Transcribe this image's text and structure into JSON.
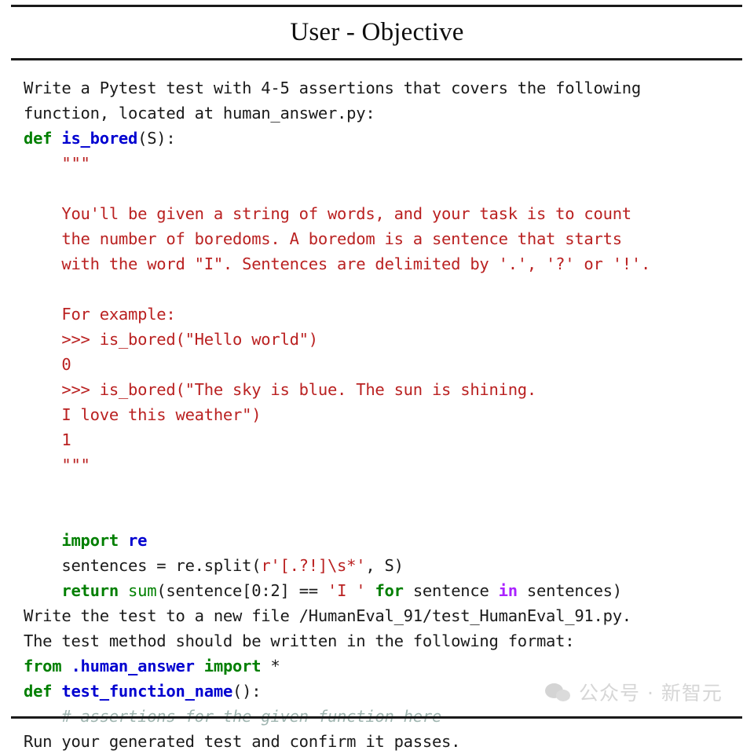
{
  "header": {
    "title": "User - Objective"
  },
  "watermark": {
    "text": "公众号 · 新智元",
    "logo_icon": "wechat-logo-icon",
    "color": "#d4d4d4"
  },
  "colors": {
    "keyword": "#007f00",
    "builtin_keyword": "#aa22ff",
    "function_name": "#0000d0",
    "builtin_function": "#008000",
    "string": "#ba2121",
    "comment": "#9fb5b0",
    "text": "#1a1a1a",
    "rule": "#1a1a1a",
    "background": "#ffffff"
  },
  "content": {
    "lines": [
      {
        "id": "intro-1",
        "segments": [
          {
            "cls": "plain",
            "t": "Write a Pytest test with 4-5 assertions that covers the following"
          }
        ]
      },
      {
        "id": "intro-2",
        "segments": [
          {
            "cls": "plain",
            "t": "function, located at human_answer.py:"
          }
        ]
      },
      {
        "id": "def-is-bored",
        "segments": [
          {
            "cls": "kw",
            "t": "def"
          },
          {
            "cls": "plain",
            "t": " "
          },
          {
            "cls": "fn",
            "t": "is_bored"
          },
          {
            "cls": "plain",
            "t": "(S):"
          }
        ]
      },
      {
        "id": "docstring-open",
        "segments": [
          {
            "cls": "str",
            "t": "    \"\"\""
          }
        ]
      },
      {
        "id": "doc-blank-1",
        "segments": [
          {
            "cls": "str",
            "t": " "
          }
        ]
      },
      {
        "id": "doc-1",
        "segments": [
          {
            "cls": "str",
            "t": "    You'll be given a string of words, and your task is to count"
          }
        ]
      },
      {
        "id": "doc-2",
        "segments": [
          {
            "cls": "str",
            "t": "    the number of boredoms. A boredom is a sentence that starts"
          }
        ]
      },
      {
        "id": "doc-3",
        "segments": [
          {
            "cls": "str",
            "t": "    with the word \"I\". Sentences are delimited by '.', '?' or '!'."
          }
        ]
      },
      {
        "id": "doc-blank-2",
        "segments": [
          {
            "cls": "str",
            "t": " "
          }
        ]
      },
      {
        "id": "doc-4",
        "segments": [
          {
            "cls": "str",
            "t": "    For example:"
          }
        ]
      },
      {
        "id": "doc-5",
        "segments": [
          {
            "cls": "str",
            "t": "    >>> is_bored(\"Hello world\")"
          }
        ]
      },
      {
        "id": "doc-6",
        "segments": [
          {
            "cls": "str",
            "t": "    0"
          }
        ]
      },
      {
        "id": "doc-7",
        "segments": [
          {
            "cls": "str",
            "t": "    >>> is_bored(\"The sky is blue. The sun is shining."
          }
        ]
      },
      {
        "id": "doc-8",
        "segments": [
          {
            "cls": "str",
            "t": "    I love this weather\")"
          }
        ]
      },
      {
        "id": "doc-9",
        "segments": [
          {
            "cls": "str",
            "t": "    1"
          }
        ]
      },
      {
        "id": "docstring-close",
        "segments": [
          {
            "cls": "str",
            "t": "    \"\"\""
          }
        ]
      },
      {
        "id": "code-blank-1",
        "segments": [
          {
            "cls": "plain",
            "t": " "
          }
        ]
      },
      {
        "id": "code-blank-2",
        "segments": [
          {
            "cls": "plain",
            "t": " "
          }
        ]
      },
      {
        "id": "code-import",
        "segments": [
          {
            "cls": "plain",
            "t": "    "
          },
          {
            "cls": "kw",
            "t": "import"
          },
          {
            "cls": "plain",
            "t": " "
          },
          {
            "cls": "fn",
            "t": "re"
          }
        ]
      },
      {
        "id": "code-split",
        "segments": [
          {
            "cls": "plain",
            "t": "    sentences = re.split("
          },
          {
            "cls": "str",
            "t": "r'[.?!]\\s*'"
          },
          {
            "cls": "plain",
            "t": ", S)"
          }
        ]
      },
      {
        "id": "code-return",
        "segments": [
          {
            "cls": "plain",
            "t": "    "
          },
          {
            "cls": "kw",
            "t": "return"
          },
          {
            "cls": "plain",
            "t": " "
          },
          {
            "cls": "builtin",
            "t": "sum"
          },
          {
            "cls": "plain",
            "t": "(sentence[0:2] == "
          },
          {
            "cls": "str",
            "t": "'I '"
          },
          {
            "cls": "plain",
            "t": " "
          },
          {
            "cls": "kw",
            "t": "for"
          },
          {
            "cls": "plain",
            "t": " sentence "
          },
          {
            "cls": "bkw",
            "t": "in"
          },
          {
            "cls": "plain",
            "t": " sentences)"
          }
        ]
      },
      {
        "id": "outro-1",
        "segments": [
          {
            "cls": "plain",
            "t": "Write the test to a new file /HumanEval_91/test_HumanEval_91.py."
          }
        ]
      },
      {
        "id": "outro-2",
        "segments": [
          {
            "cls": "plain",
            "t": "The test method should be written in the following format:"
          }
        ]
      },
      {
        "id": "fmt-from",
        "segments": [
          {
            "cls": "kw",
            "t": "from"
          },
          {
            "cls": "plain",
            "t": " "
          },
          {
            "cls": "fn",
            "t": ".human_answer"
          },
          {
            "cls": "plain",
            "t": " "
          },
          {
            "cls": "kw",
            "t": "import"
          },
          {
            "cls": "plain",
            "t": " *"
          }
        ]
      },
      {
        "id": "fmt-def",
        "segments": [
          {
            "cls": "kw",
            "t": "def"
          },
          {
            "cls": "plain",
            "t": " "
          },
          {
            "cls": "fn",
            "t": "test_function_name"
          },
          {
            "cls": "plain",
            "t": "():"
          }
        ]
      },
      {
        "id": "fmt-comment",
        "segments": [
          {
            "cls": "cmt",
            "t": "    # assertions for the given function here"
          }
        ]
      },
      {
        "id": "outro-3",
        "segments": [
          {
            "cls": "plain",
            "t": "Run your generated test and confirm it passes."
          }
        ]
      }
    ]
  }
}
